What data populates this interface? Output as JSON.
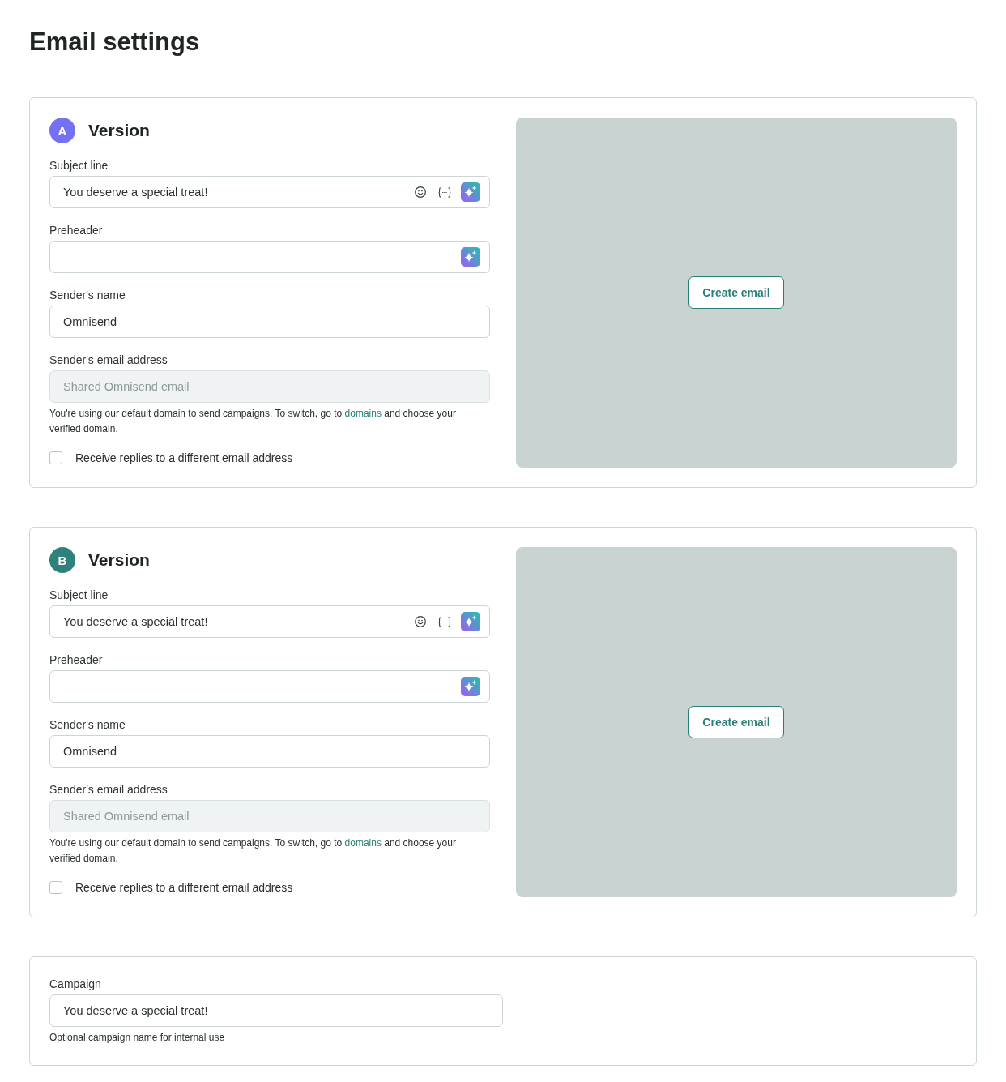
{
  "title": "Email settings",
  "versions": [
    {
      "badge": "A",
      "color": "#7472f2",
      "title": "Version",
      "fields": [
        {
          "kind": "subject",
          "label": "Subject line",
          "value": "You deserve a special treat!",
          "disabled": false
        },
        {
          "kind": "preheader",
          "label": "Preheader",
          "disabled": false
        },
        {
          "kind": "sender_name",
          "label": "Sender's name",
          "value": "Omnisend",
          "disabled": false
        },
        {
          "kind": "sender_email",
          "label": "Sender's email address",
          "placeholder": "Shared Omnisend email",
          "disabled": true,
          "hint": {
            "before": "You're using our default domain to send campaigns. To switch, go to",
            "link": "domains",
            "after": "and choose your verified domain."
          }
        }
      ],
      "reply_checkbox": {
        "label": "Receive replies to a different email address",
        "checked": false
      },
      "preview": {
        "button": "Create email"
      }
    },
    {
      "badge": "B",
      "color": "#2f827b",
      "title": "Version",
      "fields": [
        {
          "kind": "subject",
          "label": "Subject line",
          "value": "You deserve a special treat!",
          "disabled": false
        },
        {
          "kind": "preheader",
          "label": "Preheader",
          "disabled": false
        },
        {
          "kind": "sender_name",
          "label": "Sender's name",
          "value": "Omnisend",
          "disabled": false
        },
        {
          "kind": "sender_email",
          "label": "Sender's email address",
          "placeholder": "Shared Omnisend email",
          "disabled": true,
          "hint": {
            "before": "You're using our default domain to send campaigns. To switch, go to",
            "link": "domains",
            "after": "and choose your verified domain."
          }
        }
      ],
      "reply_checkbox": {
        "label": "Receive replies to a different email address",
        "checked": false
      },
      "preview": {
        "button": "Create email"
      }
    }
  ],
  "campaign": {
    "label": "Campaign",
    "value": "You deserve a special treat!",
    "hint": "Optional campaign name for internal use"
  }
}
